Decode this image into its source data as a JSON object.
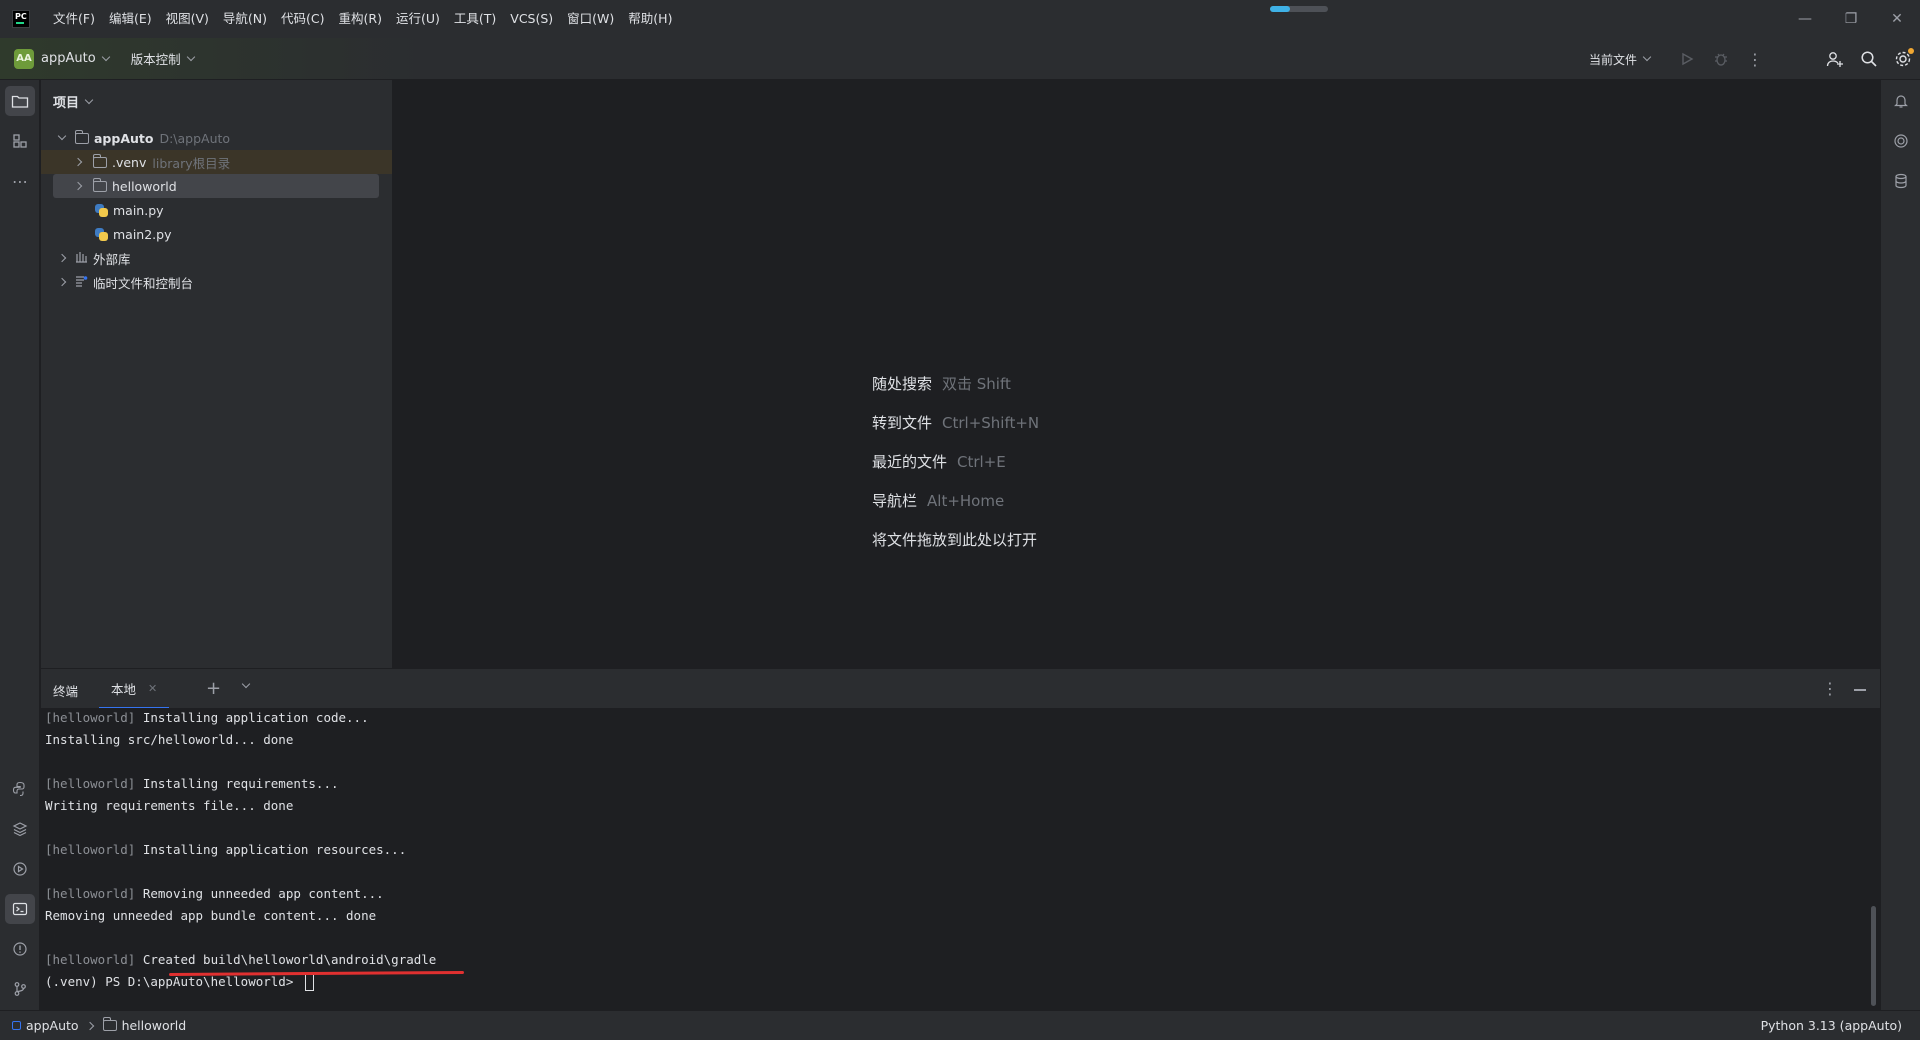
{
  "menu": [
    "文件(F)",
    "编辑(E)",
    "视图(V)",
    "导航(N)",
    "代码(C)",
    "重构(R)",
    "运行(U)",
    "工具(T)",
    "VCS(S)",
    "窗口(W)",
    "帮助(H)"
  ],
  "progress": {
    "value": 0.35,
    "color": "#3fb1e6"
  },
  "toolbar": {
    "avatar": "AA",
    "project": "appAuto",
    "vcs": "版本控制",
    "run_config": "当前文件"
  },
  "project_panel": {
    "title": "项目",
    "root": {
      "name": "appAuto",
      "path": "D:\\appAuto"
    },
    "venv": {
      "name": ".venv",
      "note": "library根目录"
    },
    "items": [
      "helloworld",
      "main.py",
      "main2.py"
    ],
    "external_libs": "外部库",
    "scratches": "临时文件和控制台"
  },
  "editor_hints": [
    {
      "label": "随处搜索",
      "key": "双击 Shift"
    },
    {
      "label": "转到文件",
      "key": "Ctrl+Shift+N"
    },
    {
      "label": "最近的文件",
      "key": "Ctrl+E"
    },
    {
      "label": "导航栏",
      "key": "Alt+Home"
    },
    {
      "label": "将文件拖放到此处以打开",
      "key": ""
    }
  ],
  "terminal": {
    "title": "终端",
    "tab": "本地",
    "prefix": "[helloworld]",
    "lines": {
      "l1": " Installing application code...",
      "l2": "Installing src/helloworld... done",
      "l3": " Installing requirements...",
      "l4": "Writing requirements file... done",
      "l5": " Installing application resources...",
      "l6": " Removing unneeded app content...",
      "l7": "Removing unneeded app bundle content... done",
      "l8": " Created build\\helloworld\\android\\gradle",
      "prompt": "(.venv) PS D:\\appAuto\\helloworld> "
    }
  },
  "statusbar": {
    "crumb1": "appAuto",
    "crumb2": "helloworld",
    "interpreter": "Python 3.13 (appAuto)"
  },
  "colors": {
    "accent": "#3574f0",
    "annotation": "#e03030",
    "avatar": "#6e9b3a"
  }
}
